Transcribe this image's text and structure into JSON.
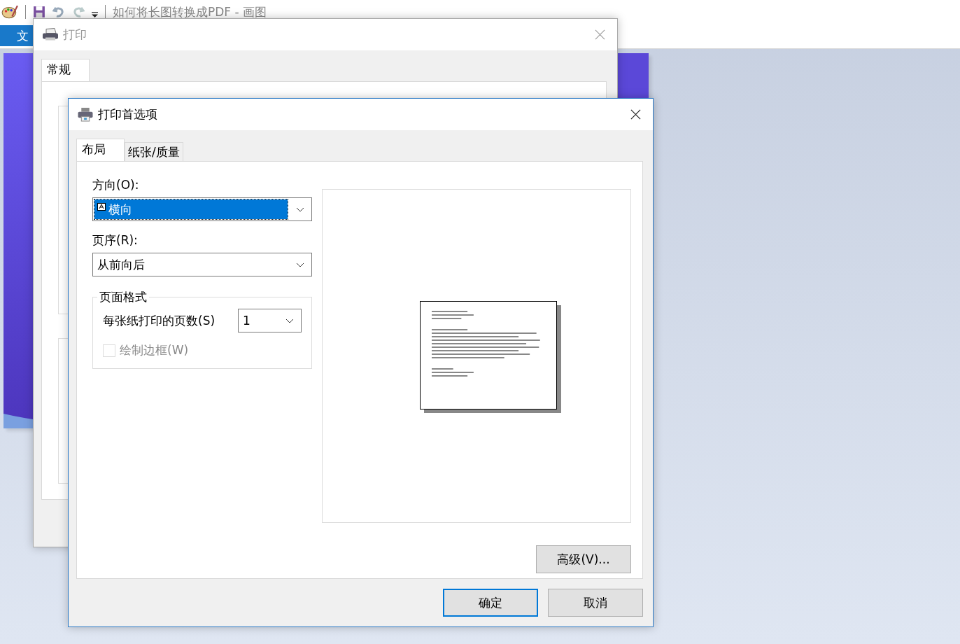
{
  "app": {
    "title": "如何将长图转换成PDF - 画图",
    "ribbon_tab": "文"
  },
  "print_dialog": {
    "title": "打印",
    "active": false,
    "tabs": [
      {
        "label": "常规",
        "selected": true
      }
    ]
  },
  "preferences_dialog": {
    "title": "打印首选项",
    "active": true,
    "tabs": [
      {
        "label": "布局",
        "selected": true
      },
      {
        "label": "纸张/质量",
        "selected": false
      }
    ],
    "orientation": {
      "label": "方向(O):",
      "value": "横向",
      "focused": true
    },
    "page_order": {
      "label": "页序(R):",
      "value": "从前向后",
      "focused": false
    },
    "page_format": {
      "title": "页面格式",
      "pages_per_sheet": {
        "label": "每张纸打印的页数(S)",
        "value": "1"
      },
      "draw_borders": {
        "label": "绘制边框(W)",
        "checked": false,
        "disabled": true
      }
    },
    "advanced_button": "高级(V)...",
    "buttons": [
      {
        "label": "确定",
        "default": true
      },
      {
        "label": "取消",
        "default": false
      }
    ]
  }
}
